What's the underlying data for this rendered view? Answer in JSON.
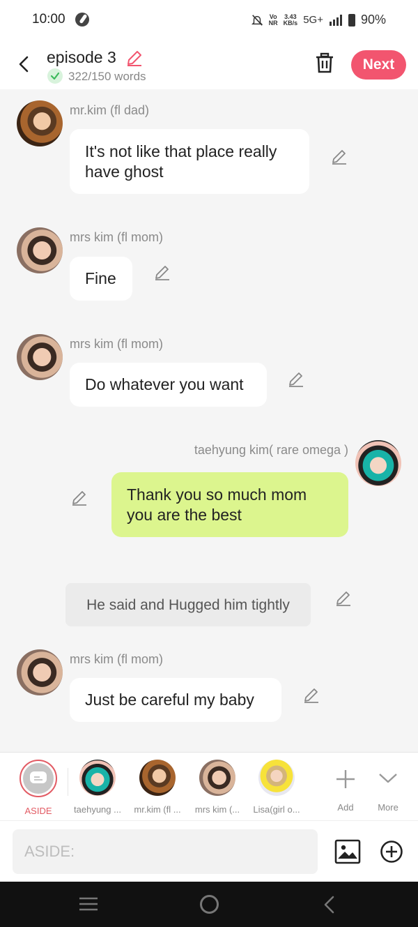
{
  "status_bar": {
    "time": "10:00",
    "network_top": "Vo",
    "network_bottom": "NR",
    "speed_top": "3.43",
    "speed_bottom": "KB/s",
    "network_type": "5G+",
    "battery": "90%"
  },
  "header": {
    "title": "episode 3",
    "word_count": "322/150 words",
    "next_label": "Next",
    "accent_color": "#f2556f"
  },
  "messages": [
    {
      "sender": "mr.kim (fl dad)",
      "text": "It's not like that place really have ghost",
      "side": "left",
      "avatar": "avatar-dad"
    },
    {
      "sender": "mrs kim (fl mom)",
      "text": "Fine",
      "side": "left",
      "avatar": "avatar-mom"
    },
    {
      "sender": "mrs kim (fl mom)",
      "text": "Do whatever you want",
      "side": "left",
      "avatar": "avatar-mom"
    },
    {
      "sender": "taehyung kim( rare omega )",
      "text": "Thank you so much mom you are the best",
      "side": "right",
      "avatar": "avatar-taehyung"
    },
    {
      "sender": "",
      "text": "He said and Hugged him tightly",
      "side": "aside",
      "avatar": ""
    },
    {
      "sender": "mrs kim (fl mom)",
      "text": "Just be careful my baby",
      "side": "left",
      "avatar": "avatar-mom"
    }
  ],
  "characters": [
    {
      "label": "ASIDE"
    },
    {
      "label": "taehyung ..."
    },
    {
      "label": "mr.kim (fl ..."
    },
    {
      "label": "mrs kim (..."
    },
    {
      "label": "Lisa(girl o..."
    }
  ],
  "char_actions": {
    "add_label": "Add",
    "more_label": "More"
  },
  "input": {
    "placeholder": "ASIDE:"
  }
}
